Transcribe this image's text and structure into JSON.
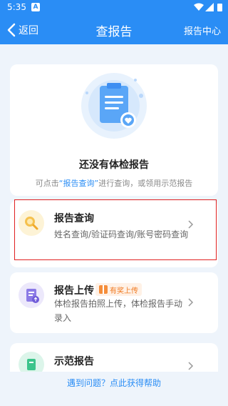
{
  "status_bar": {
    "time": "5:35",
    "notification_letter": "A"
  },
  "nav": {
    "back_label": "返回",
    "title": "查报告",
    "right_label": "报告中心"
  },
  "empty": {
    "title": "还没有体检报告",
    "hint_prefix": "可点击",
    "hint_link": "“报告查询”",
    "hint_suffix": "进行查询，或领用示范报告"
  },
  "options": [
    {
      "title": "报告查询",
      "desc": "姓名查询/验证码查询/账号密码查询"
    },
    {
      "title": "报告上传",
      "badge": "有奖上传",
      "desc": "体检报告拍照上传，体检报告手动录入"
    },
    {
      "title": "示范报告",
      "desc": ""
    }
  ],
  "help_text": "遇到问题？点此获得帮助",
  "colors": {
    "brand": "#2a8df5",
    "highlight": "#e02020",
    "badge": "#f07a22"
  }
}
